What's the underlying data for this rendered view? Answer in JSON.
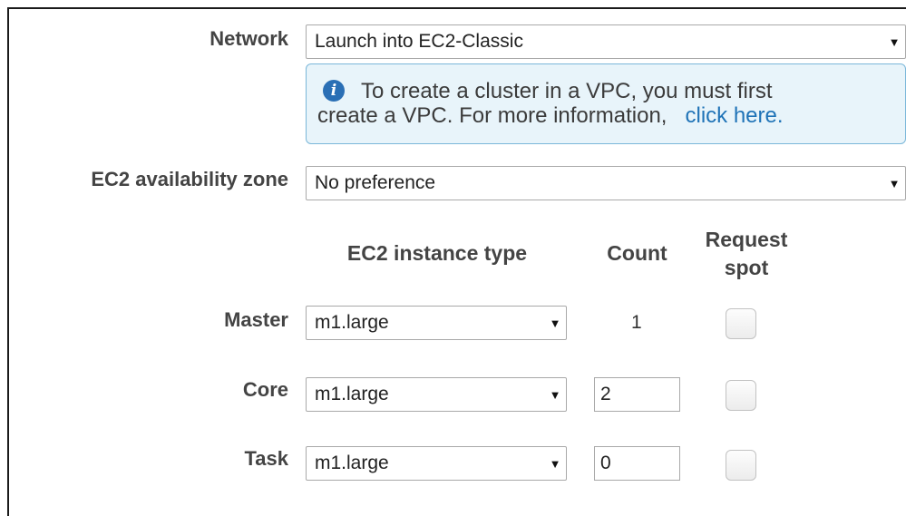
{
  "network": {
    "label": "Network",
    "selected": "Launch into EC2-Classic",
    "info": {
      "icon": "info-icon",
      "text_line1": "To create a cluster in a VPC, you must first",
      "text_line2": "create a VPC. For more information,",
      "link": "click here."
    }
  },
  "zone": {
    "label": "EC2 availability zone",
    "selected": "No preference"
  },
  "instances": {
    "headers": {
      "type": "EC2 instance type",
      "count": "Count",
      "spot_line1": "Request",
      "spot_line2": "spot"
    },
    "rows": [
      {
        "label": "Master",
        "type": "m1.large",
        "count": "1",
        "spot": false
      },
      {
        "label": "Core",
        "type": "m1.large",
        "count": "2",
        "spot": false
      },
      {
        "label": "Task",
        "type": "m1.large",
        "count": "0",
        "spot": false
      }
    ]
  }
}
